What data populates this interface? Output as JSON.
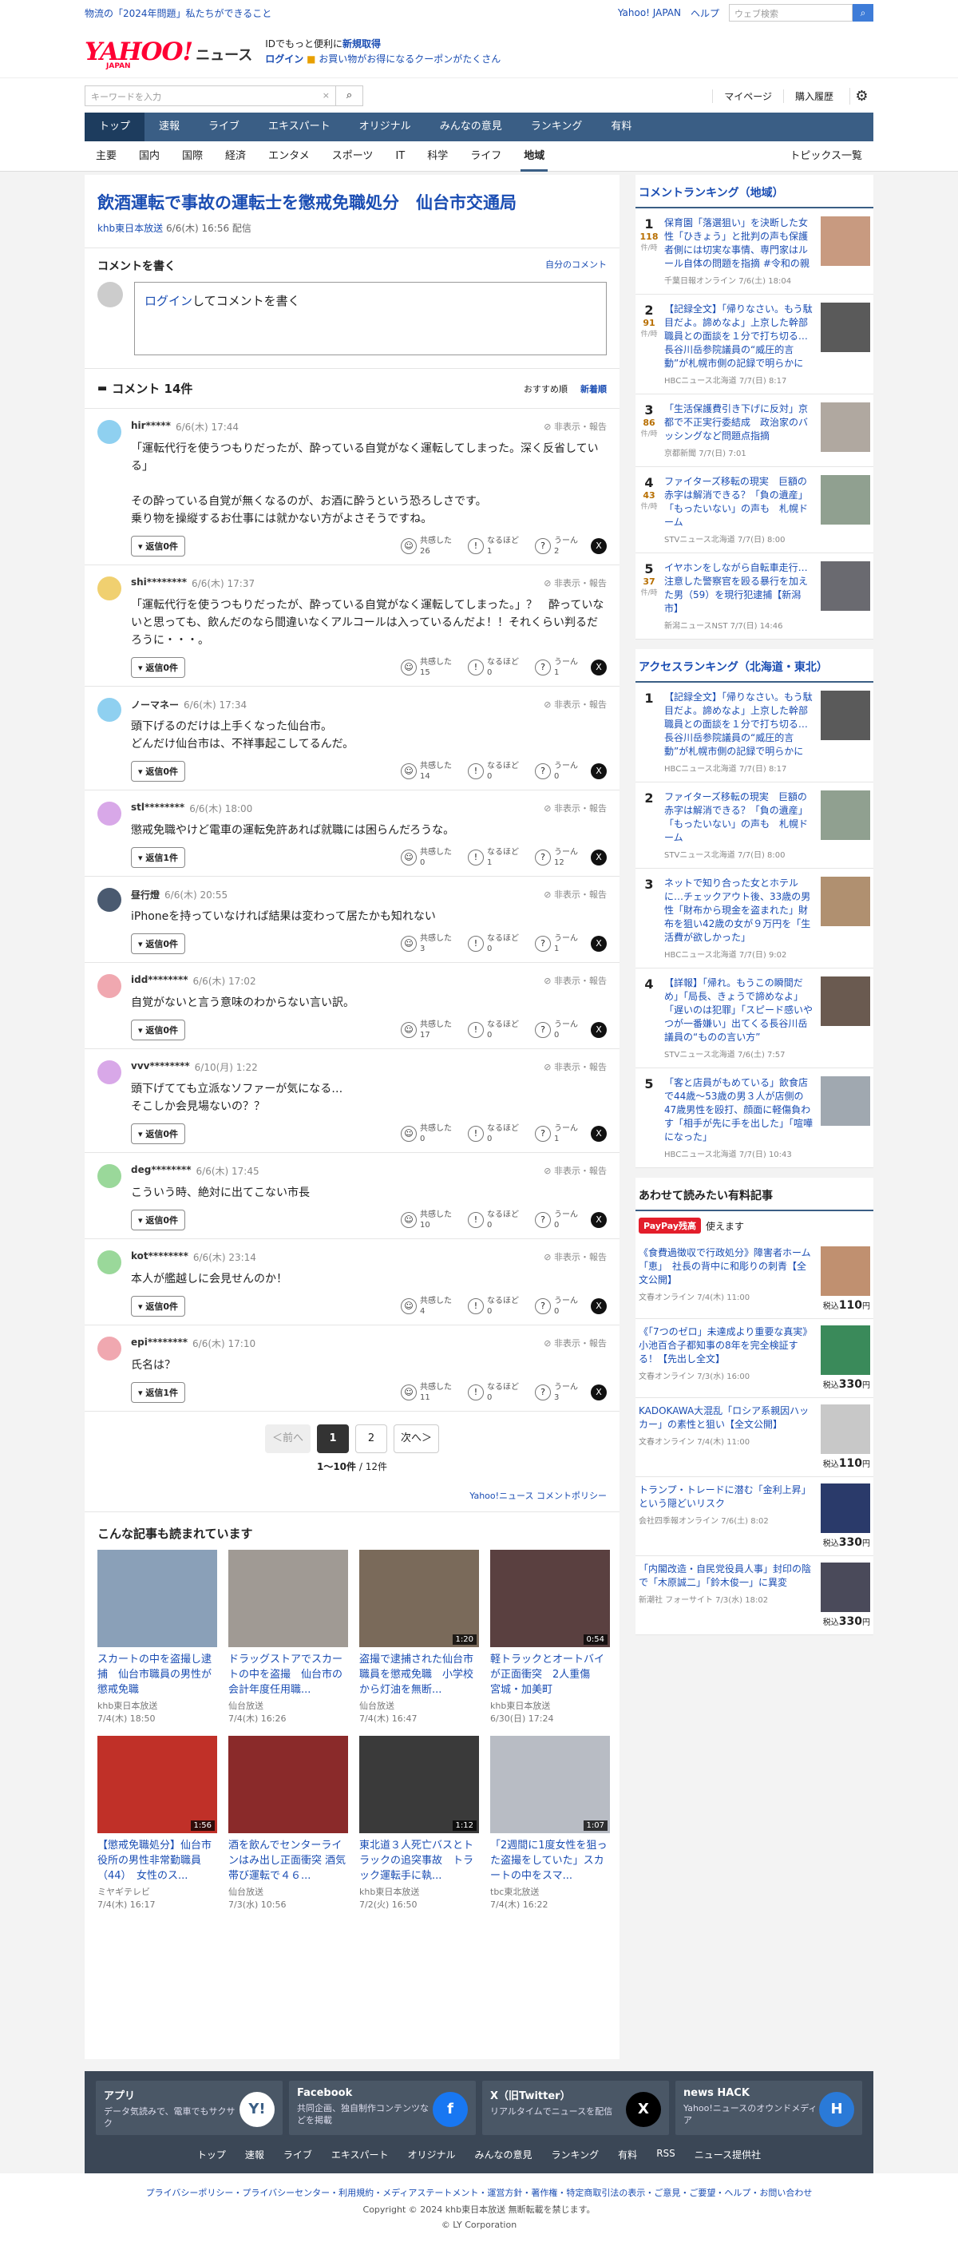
{
  "topbar": {
    "promo": "物流の「2024年問題」私たちができること",
    "home": "Yahoo! JAPAN",
    "help": "ヘルプ",
    "search_placeholder": "ウェブ検索"
  },
  "brand": {
    "logo": "YAHOO!",
    "logo_sub": "JAPAN",
    "site": "ニュース",
    "line1_a": "IDでもっと便利に",
    "line1_b": "新規取得",
    "line2_a": "ログイン",
    "line2_b": "お買い物がお得になるクーポンがたくさん"
  },
  "search": {
    "placeholder": "キーワードを入力",
    "mypage": "マイページ",
    "history": "購入履歴"
  },
  "gnav": [
    "トップ",
    "速報",
    "ライブ",
    "エキスパート",
    "オリジナル",
    "みんなの意見",
    "ランキング",
    "有料"
  ],
  "snav": [
    "主要",
    "国内",
    "国際",
    "経済",
    "エンタメ",
    "スポーツ",
    "IT",
    "科学",
    "ライフ",
    "地域"
  ],
  "snav_more": "トピックス一覧",
  "article": {
    "title": "飲酒運転で事故の運転士を懲戒免職処分　仙台市交通局",
    "source": "khb東日本放送",
    "date": "6/6(木) 16:56 配信"
  },
  "write": {
    "heading": "コメントを書く",
    "mine": "自分のコメント",
    "login": "ログイン",
    "prompt": "してコメントを書く"
  },
  "comments": {
    "count_label": "コメント 14件",
    "sort_rec": "おすすめ順",
    "sort_new": "新着順",
    "hide": "非表示・報告",
    "r1": "共感した",
    "r2": "なるほど",
    "r3": "うーん",
    "items": [
      {
        "user": "hir*****",
        "date": "6/6(木) 17:44",
        "text": "「運転代行を使うつもりだったが、酔っている自覚がなく運転してしまった。深く反省している」\n\nその酔っている自覚が無くなるのが、お酒に酔うという恐ろしさです。\n乗り物を操縦するお仕事には就かない方がよさそうですね。",
        "reply": "返信0件",
        "c": "26",
        "n": "1",
        "u": "2",
        "av": "#8fd0f0"
      },
      {
        "user": "shi********",
        "date": "6/6(木) 17:37",
        "text": "「運転代行を使うつもりだったが、酔っている自覚がなく運転してしまった。」？　酔っていないと思っても、飲んだのなら間違いなくアルコールは入っているんだよ！！それくらい判るだろうに・・・。",
        "reply": "返信0件",
        "c": "15",
        "n": "0",
        "u": "1",
        "av": "#f0d070"
      },
      {
        "user": "ノーマネー",
        "date": "6/6(木) 17:34",
        "text": "頭下げるのだけは上手くなった仙台市。\nどんだけ仙台市は、不祥事起こしてるんだ。",
        "reply": "返信0件",
        "c": "14",
        "n": "0",
        "u": "0",
        "av": "#8fd0f0"
      },
      {
        "user": "stl********",
        "date": "6/6(木) 18:00",
        "text": "懲戒免職やけど電車の運転免許あれば就職には困らんだろうな。",
        "reply": "返信1件",
        "c": "0",
        "n": "1",
        "u": "12",
        "av": "#d8a8e8"
      },
      {
        "user": "昼行燈",
        "date": "6/6(木) 20:55",
        "text": "iPhoneを持っていなければ結果は変わって居たかも知れない",
        "reply": "返信0件",
        "c": "3",
        "n": "0",
        "u": "1",
        "av": "#4a5a70"
      },
      {
        "user": "idd********",
        "date": "6/6(木) 17:02",
        "text": "自覚がないと言う意味のわからない言い訳。",
        "reply": "返信0件",
        "c": "17",
        "n": "0",
        "u": "0",
        "av": "#f0a8b0"
      },
      {
        "user": "vvv********",
        "date": "6/10(月) 1:22",
        "text": "頭下げてても立派なソファーが気になる…\nそこしか会見場ないの？？",
        "reply": "返信0件",
        "c": "0",
        "n": "0",
        "u": "1",
        "av": "#d8a8e8"
      },
      {
        "user": "deg********",
        "date": "6/6(木) 17:45",
        "text": "こういう時、絶対に出てこない市長",
        "reply": "返信0件",
        "c": "10",
        "n": "0",
        "u": "0",
        "av": "#9ad89a"
      },
      {
        "user": "kot********",
        "date": "6/6(木) 23:14",
        "text": "本人が艦越しに会見せんのか！",
        "reply": "返信0件",
        "c": "4",
        "n": "0",
        "u": "0",
        "av": "#9ad89a"
      },
      {
        "user": "epi********",
        "date": "6/6(木) 17:10",
        "text": "氏名は？",
        "reply": "返信1件",
        "c": "11",
        "n": "0",
        "u": "3",
        "av": "#f0a8b0"
      }
    ]
  },
  "pager": {
    "prev": "＜前へ",
    "p1": "1",
    "p2": "2",
    "next": "次へ＞",
    "count_a": "1〜10件",
    "count_b": " / 12件",
    "policy": "Yahoo!ニュース コメントポリシー"
  },
  "related": {
    "heading": "こんな記事も読まれています",
    "items": [
      {
        "title": "スカートの中を盗撮し逮捕　仙台市職員の男性が懲戒免職",
        "src": "khb東日本放送",
        "date": "7/4(木) 18:50",
        "dur": "",
        "col": "#8aa0b8"
      },
      {
        "title": "ドラッグストアでスカートの中を盗撮　仙台市の会計年度任用職...",
        "src": "仙台放送",
        "date": "7/4(木) 16:26",
        "dur": "",
        "col": "#a09a94"
      },
      {
        "title": "盗撮で逮捕された仙台市職員を懲戒免職　小学校から灯油を無断...",
        "src": "仙台放送",
        "date": "7/4(木) 16:47",
        "dur": "1:20",
        "col": "#7a6a5a"
      },
      {
        "title": "軽トラックとオートバイが正面衝突　2人重傷　宮城・加美町",
        "src": "khb東日本放送",
        "date": "6/30(日) 17:24",
        "dur": "0:54",
        "col": "#5a4040"
      },
      {
        "title": "【懲戒免職処分】仙台市役所の男性非常勤職員（44）　女性のス...",
        "src": "ミヤギテレビ",
        "date": "7/4(木) 16:17",
        "dur": "1:56",
        "col": "#c03028"
      },
      {
        "title": "酒を飲んでセンターラインはみ出し正面衝突 酒気帯び運転で４６...",
        "src": "仙台放送",
        "date": "7/3(水) 10:56",
        "dur": "",
        "col": "#8a2a2a"
      },
      {
        "title": "東北道３人死亡バスとトラックの追突事故　トラック運転手に執...",
        "src": "khb東日本放送",
        "date": "7/2(火) 16:50",
        "dur": "1:12",
        "col": "#3a3a3a"
      },
      {
        "title": "「2週間に1度女性を狙った盗撮をしていた」スカートの中をスマ...",
        "src": "tbc東北放送",
        "date": "7/4(木) 16:22",
        "dur": "1:07",
        "col": "#b8bcc4"
      }
    ]
  },
  "ranking1": {
    "heading": "コメントランキング（地域）",
    "unit": "件/時",
    "items": [
      {
        "no": "1",
        "cnt": "118",
        "title": "保育園「落選狙い」を決断した女性「ひきょう」と批判の声も保護者側には切実な事情、専門家はルール自体の問題を指摘 #令和の親",
        "src": "千葉日報オンライン",
        "date": "7/6(土) 18:04",
        "col": "#c89a80"
      },
      {
        "no": "2",
        "cnt": "91",
        "title": "【記録全文】「帰りなさい。もう駄目だよ。諦めなよ」上京した幹部職員との面談を１分で打ち切る…長谷川岳参院議員の“威圧的言動”が札幌市側の記録で明らかに",
        "src": "HBCニュース北海道",
        "date": "7/7(日) 8:17",
        "col": "#5a5a5a"
      },
      {
        "no": "3",
        "cnt": "86",
        "title": "「生活保護費引き下げに反対」京都で不正実行委結成　政治家のバッシングなど問題点指摘",
        "src": "京都新聞",
        "date": "7/7(日) 7:01",
        "col": "#b0a8a0"
      },
      {
        "no": "4",
        "cnt": "43",
        "title": "ファイターズ移転の現実　巨額の赤字は解消できる？「負の遺産」「もったいない」の声も　札幌ドーム",
        "src": "STVニュース北海道",
        "date": "7/7(日) 8:00",
        "col": "#90a090"
      },
      {
        "no": "5",
        "cnt": "37",
        "title": "イヤホンをしながら自転車走行…注意した警察官を殴る暴行を加えた男（59）を現行犯逮捕【新潟市】",
        "src": "新潟ニュースNST",
        "date": "7/7(日) 14:46",
        "col": "#6a6a70"
      }
    ]
  },
  "ranking2": {
    "heading": "アクセスランキング（北海道・東北）",
    "items": [
      {
        "no": "1",
        "title": "【記録全文】「帰りなさい。もう駄目だよ。諦めなよ」上京した幹部職員との面談を１分で打ち切る…長谷川岳参院議員の“威圧的言動”が札幌市側の記録で明らかに",
        "src": "HBCニュース北海道",
        "date": "7/7(日) 8:17",
        "col": "#5a5a5a"
      },
      {
        "no": "2",
        "title": "ファイターズ移転の現実　巨額の赤字は解消できる？「負の遺産」「もったいない」の声も　札幌ドーム",
        "src": "STVニュース北海道",
        "date": "7/7(日) 8:00",
        "col": "#90a090"
      },
      {
        "no": "3",
        "title": "ネットで知り合った女とホテルに…チェックアウト後、33歳の男性「財布から現金を盗まれた」財布を狙い42歳の女が９万円を「生活費が欲しかった」",
        "src": "HBCニュース北海道",
        "date": "7/7(日) 9:02",
        "col": "#b09070"
      },
      {
        "no": "4",
        "title": "【詳報】「帰れ。もうこの瞬間だめ」「局長、きょうで諦めなよ」「遅いのは犯罪」「スピード感いやつが一番嫌い」出てくる長谷川岳議員の“ものの言い方”",
        "src": "STVニュース北海道",
        "date": "7/6(土) 7:57",
        "col": "#6a5a50"
      },
      {
        "no": "5",
        "title": "「客と店員がもめている」飲食店で44歳〜53歳の男３人が店側の47歳男性を殴打、顔面に軽傷負わす「相手が先に手を出した」「喧嘩になった」",
        "src": "HBCニュース北海道",
        "date": "7/7(日) 10:43",
        "col": "#a0a8b0"
      }
    ]
  },
  "paid": {
    "heading": "あわせて読みたい有料記事",
    "paypay": "PayPay残高",
    "use": "使えます",
    "tax": "税込",
    "yen": "円",
    "items": [
      {
        "title": "《食費過徴収で行政処分》障害者ホーム「恵」　社長の背中に和彫りの刺青【全文公開】",
        "src": "文春オンライン",
        "date": "7/4(木) 11:00",
        "price": "110",
        "col": "#c09070"
      },
      {
        "title": "《「7つのゼロ」未達成より重要な真実》小池百合子都知事の8年を完全検証する！【先出し全文】",
        "src": "文春オンライン",
        "date": "7/3(水) 16:00",
        "price": "330",
        "col": "#3a8a5a"
      },
      {
        "title": "KADOKAWA大混乱「ロシア系親因ハッカー」の素性と狙い【全文公開】",
        "src": "文春オンライン",
        "date": "7/4(木) 11:00",
        "price": "110",
        "col": "#c8c8c8"
      },
      {
        "title": "トランプ・トレードに潜む「金利上昇」という隠どいリスク",
        "src": "会社四季報オンライン",
        "date": "7/6(土) 8:02",
        "price": "330",
        "col": "#2a3a6a"
      },
      {
        "title": "「内閣改造・自民党役員人事」封印の陰で「木原誠二」「鈴木俊一」に異変",
        "src": "新潮社 フォーサイト",
        "date": "7/3(水) 18:02",
        "price": "330",
        "col": "#4a4a5a"
      }
    ]
  },
  "footer": {
    "cards": [
      {
        "title": "アプリ",
        "desc": "データ気読みで、電車でもサクサク",
        "icon": "app-icon",
        "col": "#ffffff",
        "glyph": "Y!"
      },
      {
        "title": "Facebook",
        "desc": "共同企画、独自制作コンテンツなどを掲載",
        "icon": "facebook-icon",
        "col": "#1877f2",
        "glyph": "f"
      },
      {
        "title": "X（旧Twitter）",
        "desc": "リアルタイムでニュースを配信",
        "icon": "x-icon",
        "col": "#000000",
        "glyph": "X"
      },
      {
        "title": "news HACK",
        "desc": "Yahoo!ニュースのオウンドメディア",
        "icon": "newshack-icon",
        "col": "#2a7ad8",
        "glyph": "H"
      }
    ],
    "links": [
      "トップ",
      "速報",
      "ライブ",
      "エキスパート",
      "オリジナル",
      "みんなの意見",
      "ランキング",
      "有料",
      "RSS",
      "ニュース提供社"
    ]
  },
  "legal": {
    "l1": "プライバシーポリシー・プライバシーセンター・利用規約・メディアステートメント・運営方針・著作権・特定商取引法の表示・ご意見・ご要望・ヘルプ・お問い合わせ",
    "l2": "Copyright © 2024 khb東日本放送 無断転載を禁じます。",
    "l3": "© LY Corporation"
  }
}
